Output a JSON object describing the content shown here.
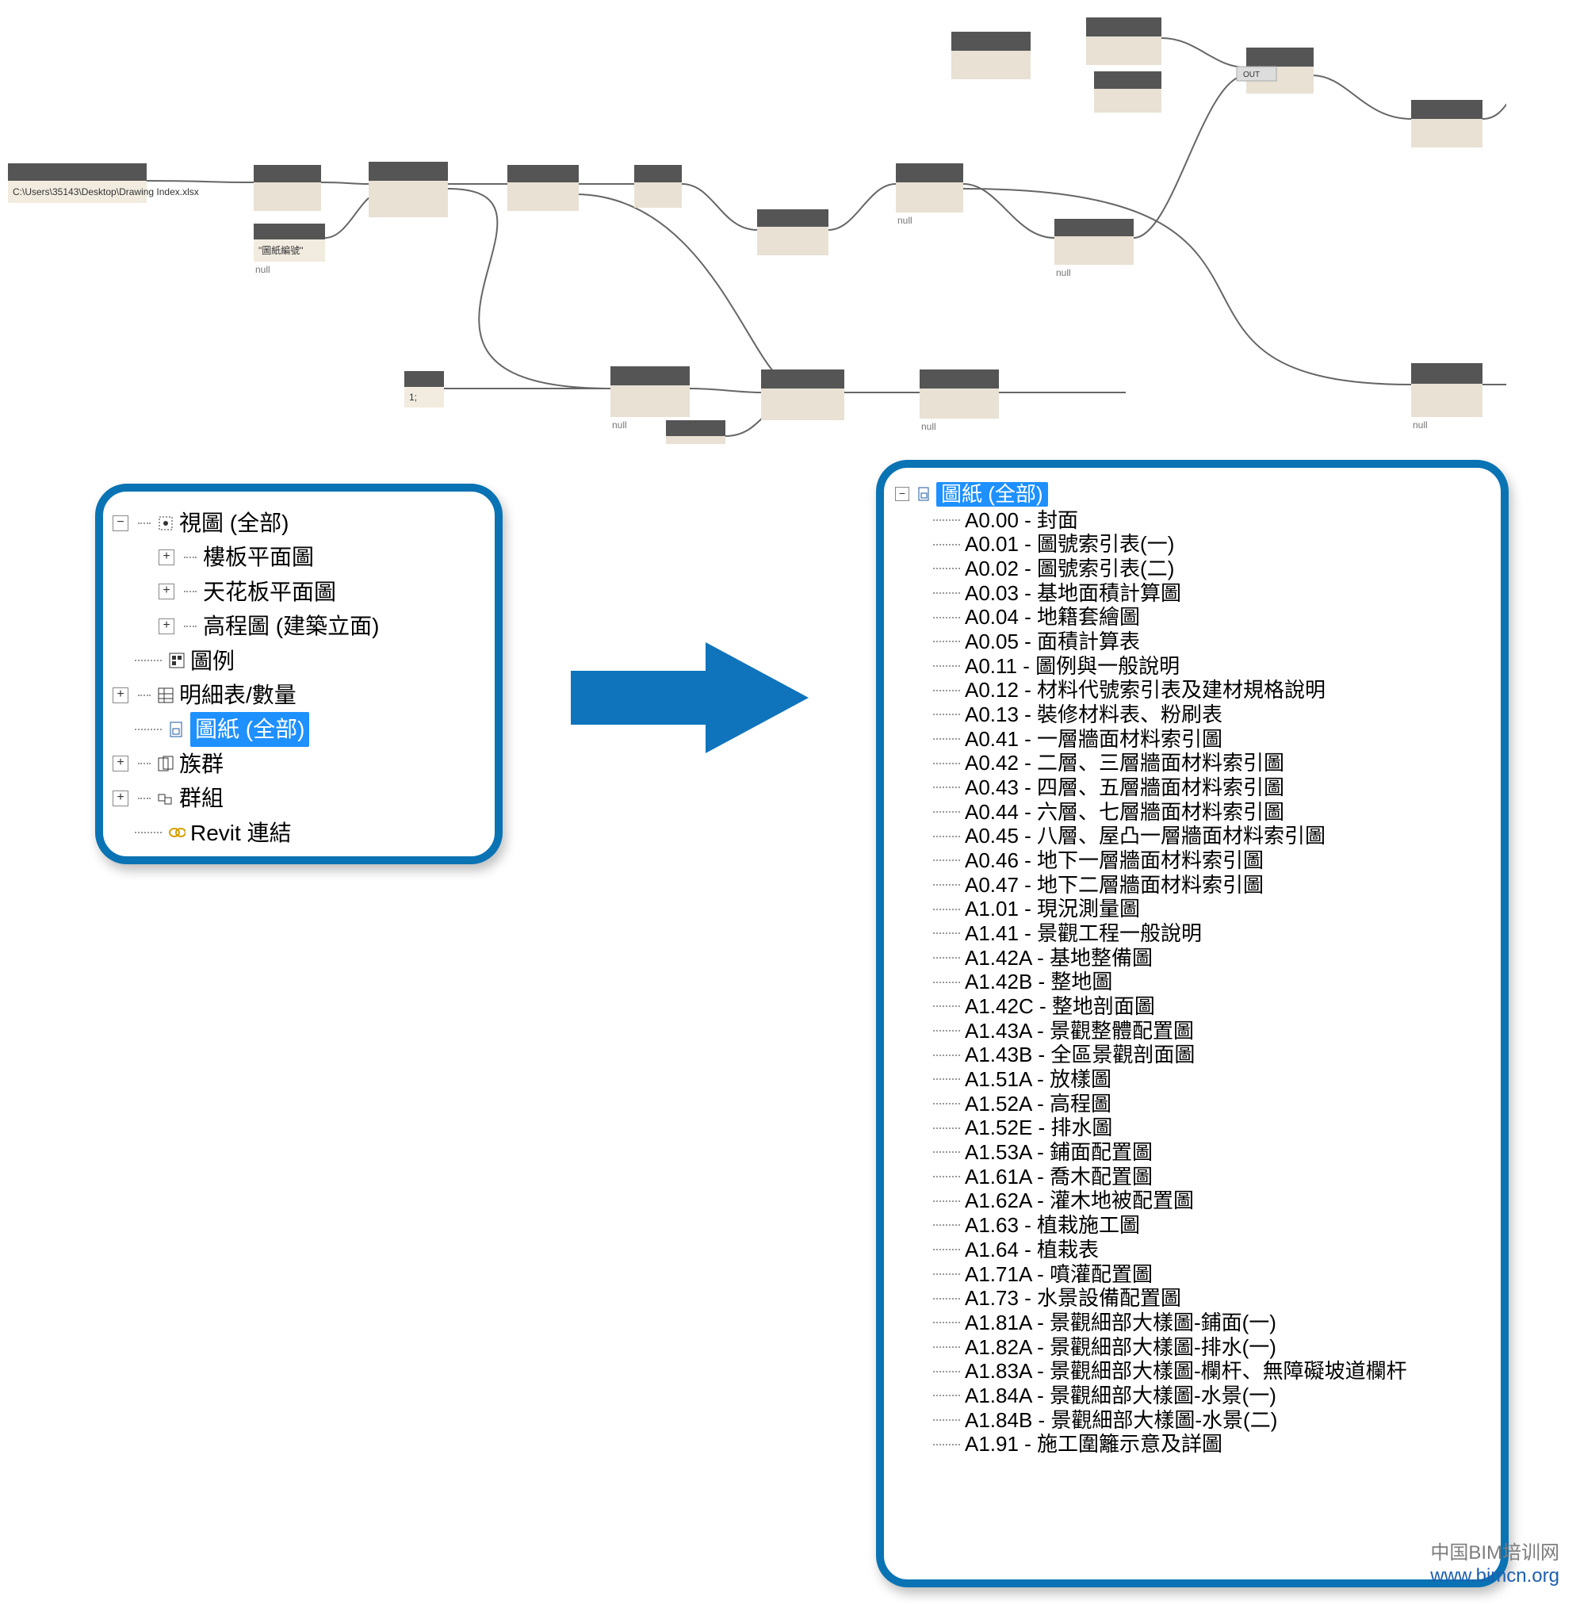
{
  "dynamo": {
    "path_node_text": "C:\\Users\\35143\\Desktop\\Drawing Index.xlsx",
    "string_node_text": "\"圖紙編號\"",
    "null_label": "null",
    "out_label": "OUT",
    "number_node_text": "1;"
  },
  "browser_left": {
    "views_all": "視圖 (全部)",
    "floor_plan": "樓板平面圖",
    "ceiling_plan": "天花板平面圖",
    "elevation": "高程圖 (建築立面)",
    "legends": "圖例",
    "schedules": "明細表/數量",
    "sheets_all": "圖紙 (全部)",
    "families": "族群",
    "groups": "群組",
    "links": "Revit 連結"
  },
  "sheets_header": "圖紙 (全部)",
  "sheets": [
    "A0.00 - 封面",
    "A0.01 - 圖號索引表(一)",
    "A0.02 - 圖號索引表(二)",
    "A0.03 - 基地面積計算圖",
    "A0.04 - 地籍套繪圖",
    "A0.05 - 面積計算表",
    "A0.11 - 圖例與一般說明",
    "A0.12 - 材料代號索引表及建材規格說明",
    "A0.13 - 裝修材料表、粉刷表",
    "A0.41 - 一層牆面材料索引圖",
    "A0.42 - 二層、三層牆面材料索引圖",
    "A0.43 - 四層、五層牆面材料索引圖",
    "A0.44 - 六層、七層牆面材料索引圖",
    "A0.45 - 八層、屋凸一層牆面材料索引圖",
    "A0.46 - 地下一層牆面材料索引圖",
    "A0.47 - 地下二層牆面材料索引圖",
    "A1.01 - 現況測量圖",
    "A1.41 - 景觀工程一般說明",
    "A1.42A - 基地整備圖",
    "A1.42B - 整地圖",
    "A1.42C - 整地剖面圖",
    "A1.43A - 景觀整體配置圖",
    "A1.43B - 全區景觀剖面圖",
    "A1.51A - 放樣圖",
    "A1.52A - 高程圖",
    "A1.52E - 排水圖",
    "A1.53A - 鋪面配置圖",
    "A1.61A - 喬木配置圖",
    "A1.62A - 灌木地被配置圖",
    "A1.63 - 植栽施工圖",
    "A1.64 - 植栽表",
    "A1.71A - 噴灌配置圖",
    "A1.73 - 水景設備配置圖",
    "A1.81A - 景觀細部大樣圖-鋪面(一)",
    "A1.82A - 景觀細部大樣圖-排水(一)",
    "A1.83A - 景觀細部大樣圖-欄杆、無障礙坡道欄杆",
    "A1.84A - 景觀細部大樣圖-水景(一)",
    "A1.84B - 景觀細部大樣圖-水景(二)",
    "A1.91 - 施工圍籬示意及詳圖"
  ],
  "watermark": {
    "cn": "中国BIM培训网",
    "url": "www.bimcn.org"
  }
}
